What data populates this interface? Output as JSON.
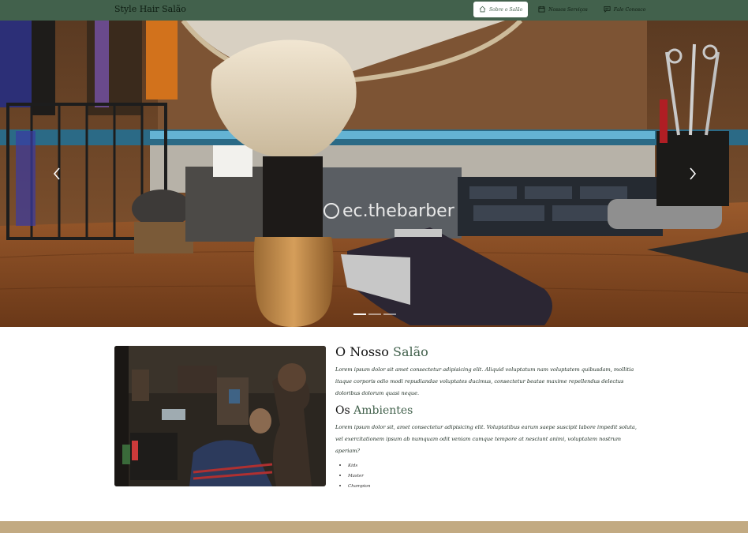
{
  "navbar": {
    "brand": "Style Hair Salão",
    "items": [
      {
        "label": "Sobre o Salão",
        "icon": "home-icon",
        "active": true
      },
      {
        "label": "Nossos Serviços",
        "icon": "calendar-icon",
        "active": false
      },
      {
        "label": "Fale Conosco",
        "icon": "chat-icon",
        "active": false
      }
    ]
  },
  "hero": {
    "image_sign": "ec.thebarber",
    "slides": 3,
    "active_slide": 0
  },
  "about": {
    "title_prefix": "O Nosso ",
    "title_accent": "Salão",
    "paragraph": "Lorem ipsum dolor sit amet consectetur adipisicing elit. Aliquid voluptatum nam voluptatem quibusdam, mollitia itaque corporis odio modi repudiandae voluptates ducimus, consectetur beatae maxime repellendus delectus doloribus dolorum quasi neque.",
    "subtitle_prefix": "Os ",
    "subtitle_accent": "Ambientes",
    "paragraph2": "Lorem ipsum dolor sit, amet consectetur adipisicing elit. Voluptatibus earum saepe suscipit labore impedit soluta, vel exercitationem ipsum ab numquam odit veniam cumque tempore at nesciunt animi, voluptatem nostrum aperiam?",
    "list": [
      "Kids",
      "Master",
      "Champion"
    ]
  },
  "colors": {
    "navbar": "#42614c",
    "accent": "#42614c",
    "footer_strip": "#c2aa82"
  }
}
